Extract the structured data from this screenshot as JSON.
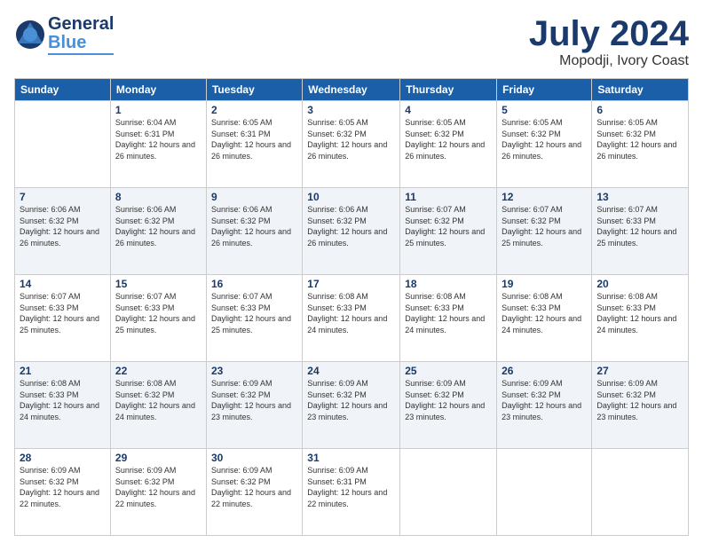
{
  "logo": {
    "part1": "General",
    "part2": "Blue"
  },
  "title": "July 2024",
  "location": "Mopodji, Ivory Coast",
  "days_header": [
    "Sunday",
    "Monday",
    "Tuesday",
    "Wednesday",
    "Thursday",
    "Friday",
    "Saturday"
  ],
  "weeks": [
    [
      {
        "day": "",
        "sunrise": "",
        "sunset": "",
        "daylight": ""
      },
      {
        "day": "1",
        "sunrise": "Sunrise: 6:04 AM",
        "sunset": "Sunset: 6:31 PM",
        "daylight": "Daylight: 12 hours and 26 minutes."
      },
      {
        "day": "2",
        "sunrise": "Sunrise: 6:05 AM",
        "sunset": "Sunset: 6:31 PM",
        "daylight": "Daylight: 12 hours and 26 minutes."
      },
      {
        "day": "3",
        "sunrise": "Sunrise: 6:05 AM",
        "sunset": "Sunset: 6:32 PM",
        "daylight": "Daylight: 12 hours and 26 minutes."
      },
      {
        "day": "4",
        "sunrise": "Sunrise: 6:05 AM",
        "sunset": "Sunset: 6:32 PM",
        "daylight": "Daylight: 12 hours and 26 minutes."
      },
      {
        "day": "5",
        "sunrise": "Sunrise: 6:05 AM",
        "sunset": "Sunset: 6:32 PM",
        "daylight": "Daylight: 12 hours and 26 minutes."
      },
      {
        "day": "6",
        "sunrise": "Sunrise: 6:05 AM",
        "sunset": "Sunset: 6:32 PM",
        "daylight": "Daylight: 12 hours and 26 minutes."
      }
    ],
    [
      {
        "day": "7",
        "sunrise": "Sunrise: 6:06 AM",
        "sunset": "Sunset: 6:32 PM",
        "daylight": "Daylight: 12 hours and 26 minutes."
      },
      {
        "day": "8",
        "sunrise": "Sunrise: 6:06 AM",
        "sunset": "Sunset: 6:32 PM",
        "daylight": "Daylight: 12 hours and 26 minutes."
      },
      {
        "day": "9",
        "sunrise": "Sunrise: 6:06 AM",
        "sunset": "Sunset: 6:32 PM",
        "daylight": "Daylight: 12 hours and 26 minutes."
      },
      {
        "day": "10",
        "sunrise": "Sunrise: 6:06 AM",
        "sunset": "Sunset: 6:32 PM",
        "daylight": "Daylight: 12 hours and 26 minutes."
      },
      {
        "day": "11",
        "sunrise": "Sunrise: 6:07 AM",
        "sunset": "Sunset: 6:32 PM",
        "daylight": "Daylight: 12 hours and 25 minutes."
      },
      {
        "day": "12",
        "sunrise": "Sunrise: 6:07 AM",
        "sunset": "Sunset: 6:32 PM",
        "daylight": "Daylight: 12 hours and 25 minutes."
      },
      {
        "day": "13",
        "sunrise": "Sunrise: 6:07 AM",
        "sunset": "Sunset: 6:33 PM",
        "daylight": "Daylight: 12 hours and 25 minutes."
      }
    ],
    [
      {
        "day": "14",
        "sunrise": "Sunrise: 6:07 AM",
        "sunset": "Sunset: 6:33 PM",
        "daylight": "Daylight: 12 hours and 25 minutes."
      },
      {
        "day": "15",
        "sunrise": "Sunrise: 6:07 AM",
        "sunset": "Sunset: 6:33 PM",
        "daylight": "Daylight: 12 hours and 25 minutes."
      },
      {
        "day": "16",
        "sunrise": "Sunrise: 6:07 AM",
        "sunset": "Sunset: 6:33 PM",
        "daylight": "Daylight: 12 hours and 25 minutes."
      },
      {
        "day": "17",
        "sunrise": "Sunrise: 6:08 AM",
        "sunset": "Sunset: 6:33 PM",
        "daylight": "Daylight: 12 hours and 24 minutes."
      },
      {
        "day": "18",
        "sunrise": "Sunrise: 6:08 AM",
        "sunset": "Sunset: 6:33 PM",
        "daylight": "Daylight: 12 hours and 24 minutes."
      },
      {
        "day": "19",
        "sunrise": "Sunrise: 6:08 AM",
        "sunset": "Sunset: 6:33 PM",
        "daylight": "Daylight: 12 hours and 24 minutes."
      },
      {
        "day": "20",
        "sunrise": "Sunrise: 6:08 AM",
        "sunset": "Sunset: 6:33 PM",
        "daylight": "Daylight: 12 hours and 24 minutes."
      }
    ],
    [
      {
        "day": "21",
        "sunrise": "Sunrise: 6:08 AM",
        "sunset": "Sunset: 6:33 PM",
        "daylight": "Daylight: 12 hours and 24 minutes."
      },
      {
        "day": "22",
        "sunrise": "Sunrise: 6:08 AM",
        "sunset": "Sunset: 6:32 PM",
        "daylight": "Daylight: 12 hours and 24 minutes."
      },
      {
        "day": "23",
        "sunrise": "Sunrise: 6:09 AM",
        "sunset": "Sunset: 6:32 PM",
        "daylight": "Daylight: 12 hours and 23 minutes."
      },
      {
        "day": "24",
        "sunrise": "Sunrise: 6:09 AM",
        "sunset": "Sunset: 6:32 PM",
        "daylight": "Daylight: 12 hours and 23 minutes."
      },
      {
        "day": "25",
        "sunrise": "Sunrise: 6:09 AM",
        "sunset": "Sunset: 6:32 PM",
        "daylight": "Daylight: 12 hours and 23 minutes."
      },
      {
        "day": "26",
        "sunrise": "Sunrise: 6:09 AM",
        "sunset": "Sunset: 6:32 PM",
        "daylight": "Daylight: 12 hours and 23 minutes."
      },
      {
        "day": "27",
        "sunrise": "Sunrise: 6:09 AM",
        "sunset": "Sunset: 6:32 PM",
        "daylight": "Daylight: 12 hours and 23 minutes."
      }
    ],
    [
      {
        "day": "28",
        "sunrise": "Sunrise: 6:09 AM",
        "sunset": "Sunset: 6:32 PM",
        "daylight": "Daylight: 12 hours and 22 minutes."
      },
      {
        "day": "29",
        "sunrise": "Sunrise: 6:09 AM",
        "sunset": "Sunset: 6:32 PM",
        "daylight": "Daylight: 12 hours and 22 minutes."
      },
      {
        "day": "30",
        "sunrise": "Sunrise: 6:09 AM",
        "sunset": "Sunset: 6:32 PM",
        "daylight": "Daylight: 12 hours and 22 minutes."
      },
      {
        "day": "31",
        "sunrise": "Sunrise: 6:09 AM",
        "sunset": "Sunset: 6:31 PM",
        "daylight": "Daylight: 12 hours and 22 minutes."
      },
      {
        "day": "",
        "sunrise": "",
        "sunset": "",
        "daylight": ""
      },
      {
        "day": "",
        "sunrise": "",
        "sunset": "",
        "daylight": ""
      },
      {
        "day": "",
        "sunrise": "",
        "sunset": "",
        "daylight": ""
      }
    ]
  ]
}
